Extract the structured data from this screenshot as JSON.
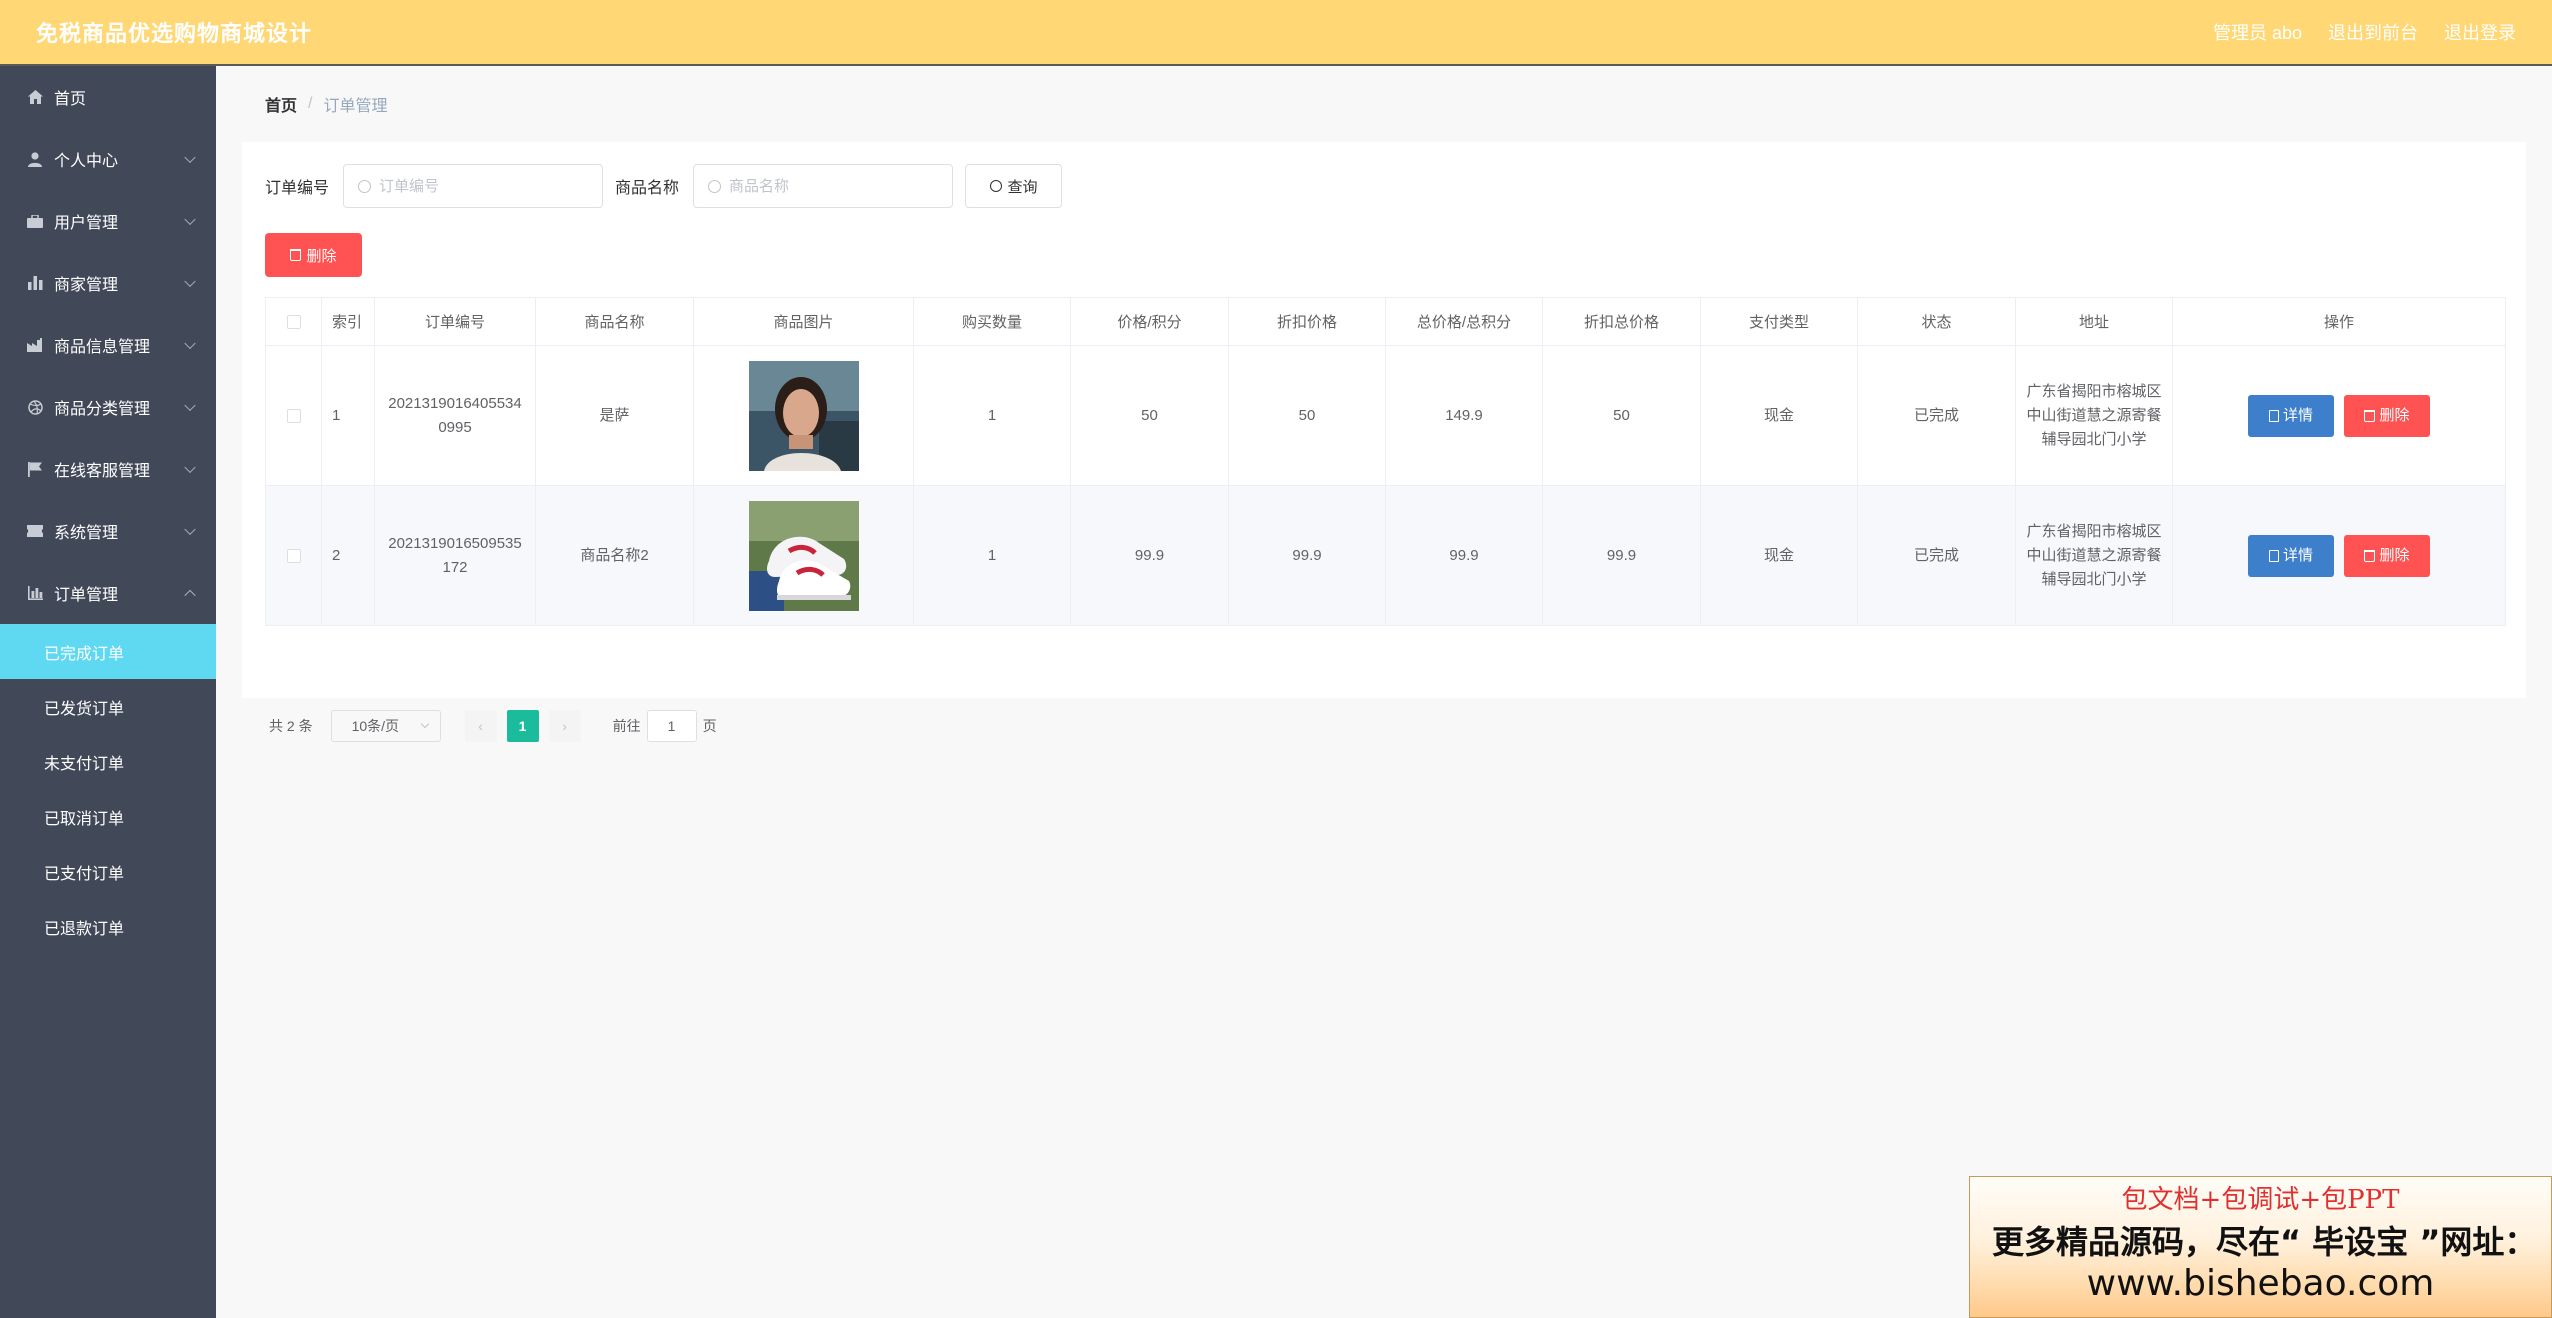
{
  "header": {
    "title": "免税商品优选购物商城设计",
    "admin": "管理员 abo",
    "to_front": "退出到前台",
    "logout": "退出登录"
  },
  "sidebar": {
    "items": [
      {
        "label": "首页",
        "icon": "home-icon"
      },
      {
        "label": "个人中心",
        "icon": "user-icon"
      },
      {
        "label": "用户管理",
        "icon": "briefcase-icon"
      },
      {
        "label": "商家管理",
        "icon": "bar-chart-icon"
      },
      {
        "label": "商品信息管理",
        "icon": "factory-icon"
      },
      {
        "label": "商品分类管理",
        "icon": "dribbble-icon"
      },
      {
        "label": "在线客服管理",
        "icon": "flag-icon"
      },
      {
        "label": "系统管理",
        "icon": "ticket-icon"
      },
      {
        "label": "订单管理",
        "icon": "order-chart-icon"
      }
    ],
    "sub_items": [
      {
        "label": "已完成订单"
      },
      {
        "label": "已发货订单"
      },
      {
        "label": "未支付订单"
      },
      {
        "label": "已取消订单"
      },
      {
        "label": "已支付订单"
      },
      {
        "label": "已退款订单"
      }
    ]
  },
  "breadcrumb": {
    "home": "首页",
    "sep": "/",
    "current": "订单管理"
  },
  "search": {
    "order_label": "订单编号",
    "order_placeholder": "订单编号",
    "product_label": "商品名称",
    "product_placeholder": "商品名称",
    "query_button": "查询"
  },
  "toolbar": {
    "delete_label": "删除"
  },
  "table": {
    "headers": [
      "索引",
      "订单编号",
      "商品名称",
      "商品图片",
      "购买数量",
      "价格/积分",
      "折扣价格",
      "总价格/总积分",
      "折扣总价格",
      "支付类型",
      "状态",
      "地址",
      "操作"
    ],
    "rows": [
      {
        "index": "1",
        "order_no": "20213190164055340995",
        "product": "是萨",
        "qty": "1",
        "price": "50",
        "discount_price": "50",
        "total": "149.9",
        "discount_total": "50",
        "pay_type": "现金",
        "status": "已完成",
        "address": "广东省揭阳市榕城区中山街道慧之源寄餐辅导园北门小学"
      },
      {
        "index": "2",
        "order_no": "2021319016509535172",
        "product": "商品名称2",
        "qty": "1",
        "price": "99.9",
        "discount_price": "99.9",
        "total": "99.9",
        "discount_total": "99.9",
        "pay_type": "现金",
        "status": "已完成",
        "address": "广东省揭阳市榕城区中山街道慧之源寄餐辅导园北门小学"
      }
    ],
    "detail_label": "详情",
    "delete_label": "删除"
  },
  "pagination": {
    "total": "共 2 条",
    "page_size": "10条/页",
    "current_page": "1",
    "goto_label": "前往",
    "goto_value": "1",
    "page_suffix": "页"
  },
  "banner": {
    "line1": "包文档+包调试+包PPT",
    "line2": "更多精品源码，尽在“ 毕设宝 ”网址：",
    "line3": "www.bishebao.com"
  },
  "colors": {
    "header_bg": "#ffd774",
    "sidebar_bg": "#414959",
    "active_sub_bg": "#5fd9f2",
    "danger": "#ff5252",
    "primary": "#3e7fcb",
    "page_active": "#1abc9c"
  }
}
